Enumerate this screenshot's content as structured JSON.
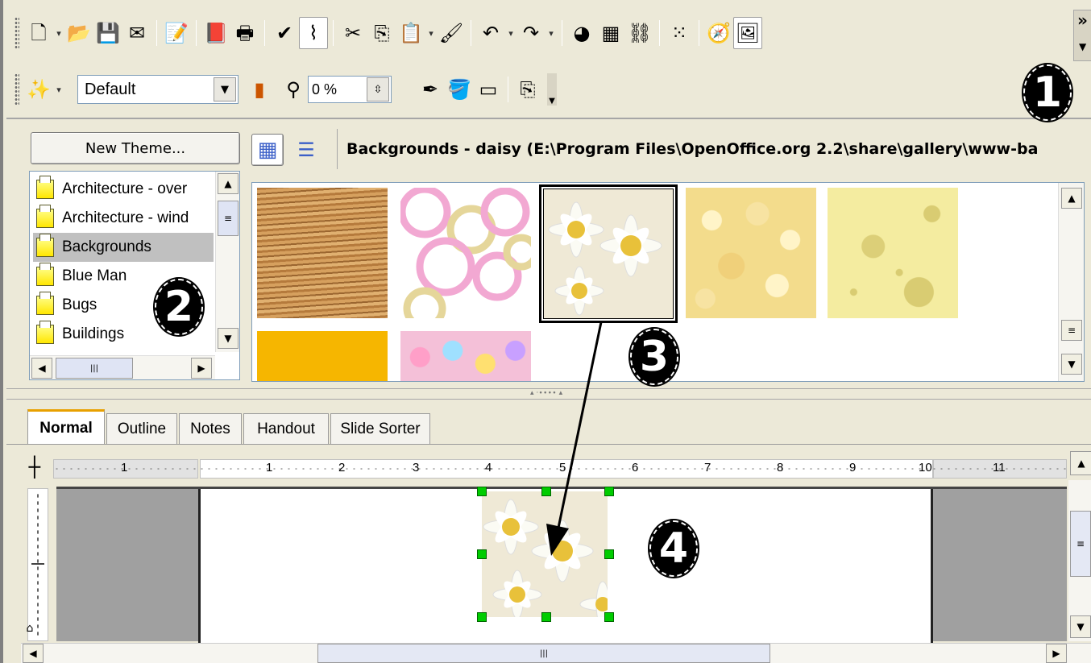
{
  "toolbar_standard": {
    "items": [
      {
        "icon": "new-document-icon",
        "glyph": "🗋",
        "dropdown": true
      },
      {
        "icon": "open-folder-icon",
        "glyph": "📂"
      },
      {
        "icon": "save-icon",
        "glyph": "💾"
      },
      {
        "icon": "email-icon",
        "glyph": "✉"
      },
      {
        "sep": true
      },
      {
        "icon": "edit-file-icon",
        "glyph": "📝"
      },
      {
        "sep": true
      },
      {
        "icon": "export-pdf-icon",
        "glyph": "📕"
      },
      {
        "icon": "print-icon",
        "glyph": "🖶"
      },
      {
        "sep": true
      },
      {
        "icon": "spellcheck-icon",
        "glyph": "✔"
      },
      {
        "icon": "autospell-icon",
        "glyph": "⌇",
        "active": true
      },
      {
        "sep": true
      },
      {
        "icon": "cut-icon",
        "glyph": "✂"
      },
      {
        "icon": "copy-icon",
        "glyph": "⎘"
      },
      {
        "icon": "paste-icon",
        "glyph": "📋",
        "dropdown": true
      },
      {
        "icon": "format-paintbrush-icon",
        "glyph": "🖌"
      },
      {
        "sep": true
      },
      {
        "icon": "undo-icon",
        "glyph": "↶",
        "dropdown": true
      },
      {
        "icon": "redo-icon",
        "glyph": "↷",
        "dropdown": true
      },
      {
        "sep": true
      },
      {
        "icon": "chart-icon",
        "glyph": "◕"
      },
      {
        "icon": "table-icon",
        "glyph": "▦"
      },
      {
        "icon": "hyperlink-icon",
        "glyph": "⛓"
      },
      {
        "sep": true
      },
      {
        "icon": "grid-icon",
        "glyph": "⁙"
      },
      {
        "sep": true
      },
      {
        "icon": "navigator-icon",
        "glyph": "🧭"
      },
      {
        "icon": "gallery-icon",
        "glyph": "🖼",
        "active": true
      }
    ],
    "overflow": "»"
  },
  "toolbar_line": {
    "style_value": "Default",
    "transparency_value": "0 %",
    "items_before": [
      {
        "icon": "magic-wand-icon",
        "glyph": "✨",
        "dropdown": true
      }
    ],
    "items_after": [
      {
        "icon": "line-icon",
        "glyph": "✒"
      },
      {
        "icon": "area-fill-icon",
        "glyph": "🪣"
      },
      {
        "icon": "shadow-icon",
        "glyph": "▭"
      },
      {
        "icon": "transform-icon",
        "glyph": "⎘"
      }
    ]
  },
  "callouts": [
    "1",
    "2",
    "3",
    "4"
  ],
  "gallery": {
    "new_theme_label": "New Theme...",
    "title": "Backgrounds - daisy (E:\\Program Files\\OpenOffice.org 2.2\\share\\gallery\\www-ba",
    "themes": [
      {
        "label": "Architecture - over",
        "selected": false
      },
      {
        "label": "Architecture - wind",
        "selected": false
      },
      {
        "label": "Backgrounds",
        "selected": true
      },
      {
        "label": "Blue Man",
        "selected": false
      },
      {
        "label": "Bugs",
        "selected": false
      },
      {
        "label": "Buildings",
        "selected": false
      }
    ]
  },
  "tabs": [
    {
      "label": "Normal",
      "active": true
    },
    {
      "label": "Outline",
      "active": false
    },
    {
      "label": "Notes",
      "active": false
    },
    {
      "label": "Handout",
      "active": false
    },
    {
      "label": "Slide Sorter",
      "active": false
    }
  ],
  "ruler": {
    "labels": [
      "1",
      "1",
      "2",
      "3",
      "4",
      "5",
      "6",
      "7",
      "8",
      "9",
      "10",
      "11"
    ]
  },
  "colors": {
    "chrome": "#ece9d8",
    "selection_handle": "#00cc00",
    "slide_grey": "#a0a0a0"
  }
}
